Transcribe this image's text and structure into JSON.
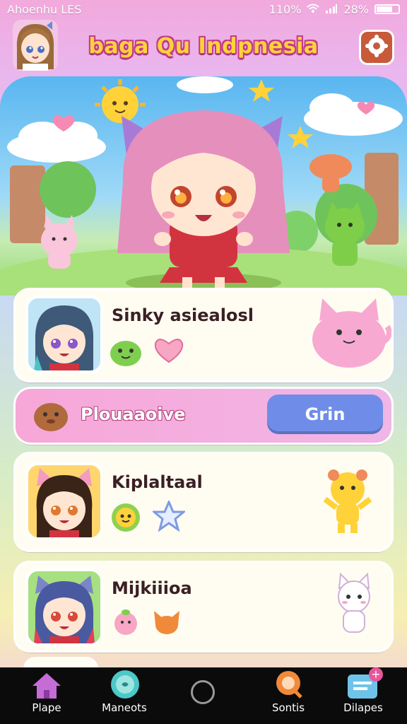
{
  "status_bar": {
    "carrier": "Ahoenhu LES",
    "signal_text": "110%",
    "battery_text": "28%"
  },
  "header": {
    "title": "baga Qu Indpnesia",
    "settings_icon": "gear-paw-icon"
  },
  "hero": {
    "scene": "main-character-scene"
  },
  "characters": [
    {
      "name": "Sinky asiealosl",
      "icons": [
        "green-slime-icon",
        "heart-icon"
      ],
      "companion": "pink-cat-blob-icon"
    },
    {
      "name": "Kiplaltaal",
      "icons": [
        "green-flower-face-icon",
        "star-icon"
      ],
      "companion": "yellow-bear-icon"
    },
    {
      "name": "Mijkiiioa",
      "icons": [
        "peach-icon",
        "orange-fox-icon"
      ],
      "companion": "white-cat-icon"
    }
  ],
  "action_bar": {
    "label": "Plouaaoive",
    "button_label": "Grin",
    "icon": "brown-critter-icon"
  },
  "nav": {
    "items": [
      {
        "label": "Plape",
        "icon": "home-icon"
      },
      {
        "label": "Maneots",
        "icon": "chat-bubble-icon"
      },
      {
        "label": "Sontis",
        "icon": "search-icon"
      },
      {
        "label": "Dilapes",
        "icon": "message-icon",
        "badge": "+"
      }
    ]
  },
  "colors": {
    "title_fill": "#ffd33a",
    "title_outline": "#c23a8a",
    "button": "#6f8de8",
    "card": "#fffdf1",
    "nav_bg": "#0b0b0b"
  }
}
